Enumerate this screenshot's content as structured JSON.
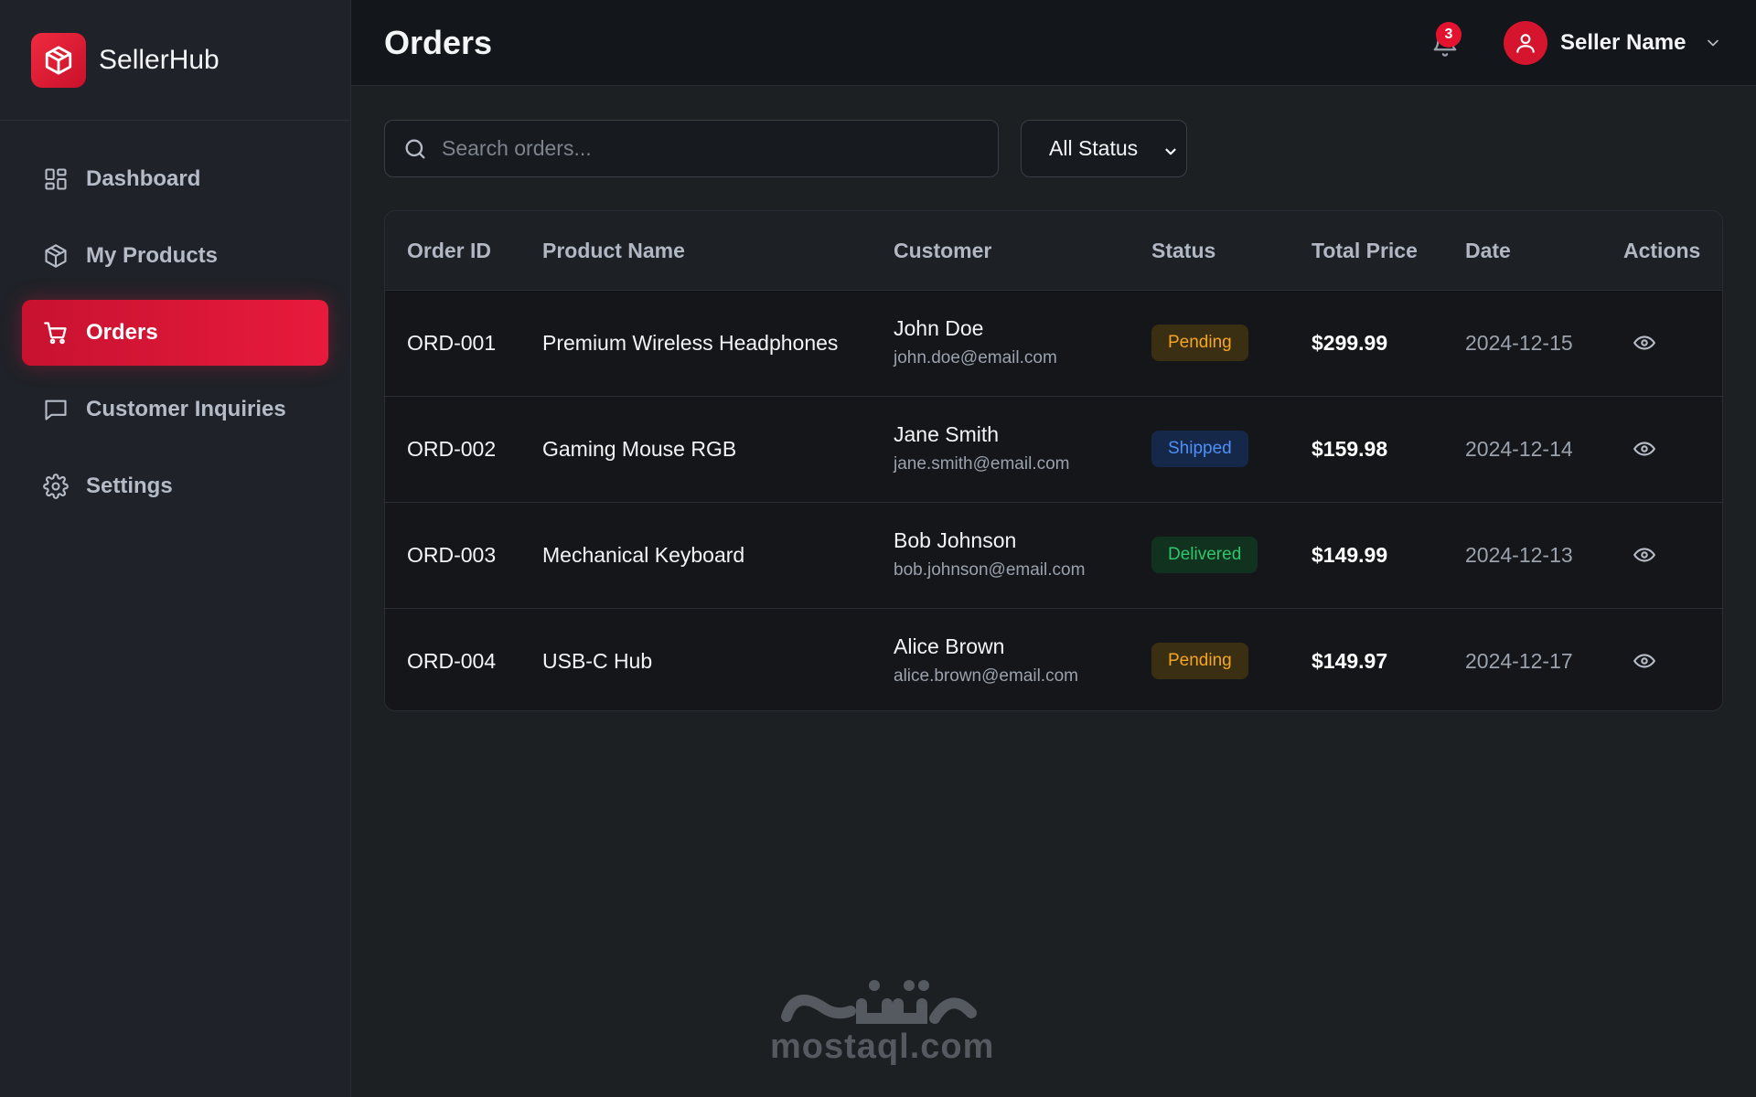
{
  "brand": {
    "name": "SellerHub"
  },
  "sidebar": {
    "items": [
      {
        "label": "Dashboard",
        "icon": "dashboard-icon",
        "active": false
      },
      {
        "label": "My Products",
        "icon": "box-icon",
        "active": false
      },
      {
        "label": "Orders",
        "icon": "cart-icon",
        "active": true
      },
      {
        "label": "Customer Inquiries",
        "icon": "chat-icon",
        "active": false
      },
      {
        "label": "Settings",
        "icon": "gear-icon",
        "active": false
      }
    ]
  },
  "header": {
    "title": "Orders",
    "notification_count": "3",
    "user_name": "Seller Name"
  },
  "toolbar": {
    "search_placeholder": "Search orders...",
    "status_filter": "All Status"
  },
  "table": {
    "columns": [
      "Order ID",
      "Product Name",
      "Customer",
      "Status",
      "Total Price",
      "Date",
      "Actions"
    ],
    "rows": [
      {
        "id": "ORD-001",
        "product": "Premium Wireless Headphones",
        "customer": "John Doe",
        "email": "john.doe@email.com",
        "status": "Pending",
        "price": "$299.99",
        "date": "2024-12-15"
      },
      {
        "id": "ORD-002",
        "product": "Gaming Mouse RGB",
        "customer": "Jane Smith",
        "email": "jane.smith@email.com",
        "status": "Shipped",
        "price": "$159.98",
        "date": "2024-12-14"
      },
      {
        "id": "ORD-003",
        "product": "Mechanical Keyboard",
        "customer": "Bob Johnson",
        "email": "bob.johnson@email.com",
        "status": "Delivered",
        "price": "$149.99",
        "date": "2024-12-13"
      },
      {
        "id": "ORD-004",
        "product": "USB-C Hub",
        "customer": "Alice Brown",
        "email": "alice.brown@email.com",
        "status": "Pending",
        "price": "$149.97",
        "date": "2024-12-17"
      }
    ]
  },
  "status_colors": {
    "Pending": {
      "bg": "#3a2f12",
      "fg": "#f5a524"
    },
    "Shipped": {
      "bg": "#15284a",
      "fg": "#4f8ff7"
    },
    "Delivered": {
      "bg": "#11321f",
      "fg": "#2fc56a"
    }
  },
  "colors": {
    "accent": "#e81a3c",
    "background": "#1c2023",
    "sidebar": "#1f2228"
  },
  "watermark": {
    "text": "mostaql.com",
    "glyph": "مستقل"
  }
}
